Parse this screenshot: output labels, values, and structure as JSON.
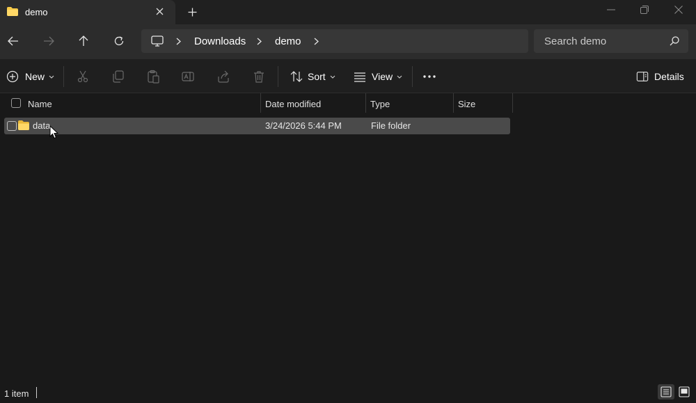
{
  "tab": {
    "title": "demo",
    "close_icon": "close-icon",
    "new_tab_icon": "plus-icon"
  },
  "window": {
    "minimize_icon": "minimize-icon",
    "restore_icon": "restore-icon",
    "close_icon": "close-icon"
  },
  "nav": {
    "back_icon": "arrow-left-icon",
    "forward_icon": "arrow-right-icon",
    "up_icon": "arrow-up-icon",
    "refresh_icon": "refresh-icon"
  },
  "address": {
    "root_icon": "monitor-icon",
    "crumbs": [
      "Downloads",
      "demo"
    ]
  },
  "search": {
    "placeholder": "Search demo"
  },
  "commands": {
    "new_label": "New",
    "sort_label": "Sort",
    "view_label": "View",
    "details_label": "Details"
  },
  "columns": {
    "name": "Name",
    "date": "Date modified",
    "type": "Type",
    "size": "Size"
  },
  "rows": [
    {
      "name": "data",
      "date": "3/24/2026 5:44 PM",
      "type": "File folder",
      "size": ""
    }
  ],
  "status": {
    "count": "1 item"
  },
  "colors": {
    "folder": "#f7c948",
    "accent": "#4a4a4a"
  }
}
